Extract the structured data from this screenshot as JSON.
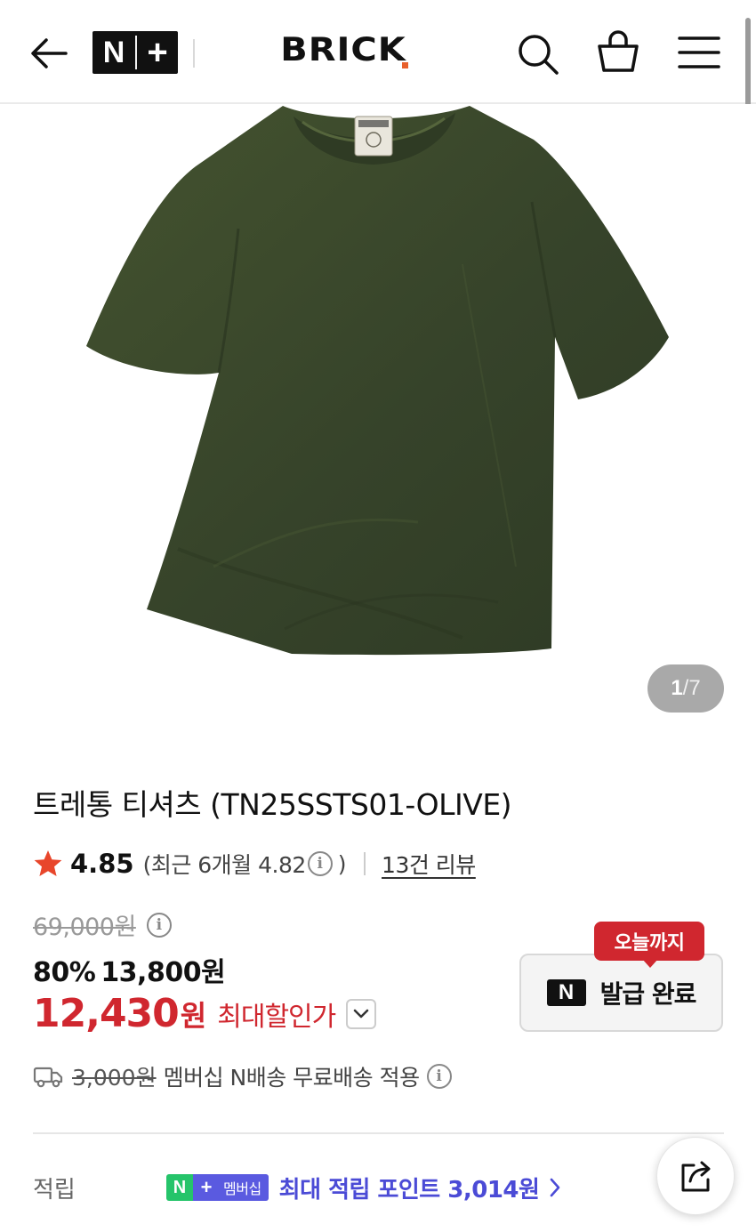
{
  "header": {
    "back_icon": "arrow-left-icon",
    "nplus_n": "N",
    "nplus_plus": "+",
    "brand": "BRICK",
    "search_icon": "search-icon",
    "cart_icon": "shopping-bag-icon",
    "menu_icon": "hamburger-menu-icon"
  },
  "gallery": {
    "current": "1",
    "total": "/7",
    "image_icon": "olive-tshirt-photo"
  },
  "product": {
    "title": "트레통 티셔츠 (TN25SSTS01-OLIVE)",
    "rating": "4.85",
    "rating_recent_prefix": "(최근 6개월 4.82",
    "rating_recent_suffix": ")",
    "review_link": "13건 리뷰",
    "original_price": "69,000원",
    "discount_rate": "80%",
    "sale_price": "13,800원",
    "max_price": "12,430",
    "max_price_unit": "원",
    "max_price_label": "최대할인가",
    "info_symbol": "i"
  },
  "coupon": {
    "tag": "오늘까지",
    "n_badge": "N",
    "label": "발급 완료"
  },
  "shipping": {
    "fee": "3,000원",
    "text": "멤버십 N배송 무료배송 적용"
  },
  "points": {
    "label": "적립",
    "badge_n": "N",
    "badge_plus": "+",
    "badge_member": "멤버십",
    "text": "최대 적립 포인트 3,014원"
  },
  "colors": {
    "accent_red": "#d0272f",
    "points_blue": "#4b4bd6",
    "star": "#e8462b",
    "olive": "#3b4a2c"
  }
}
